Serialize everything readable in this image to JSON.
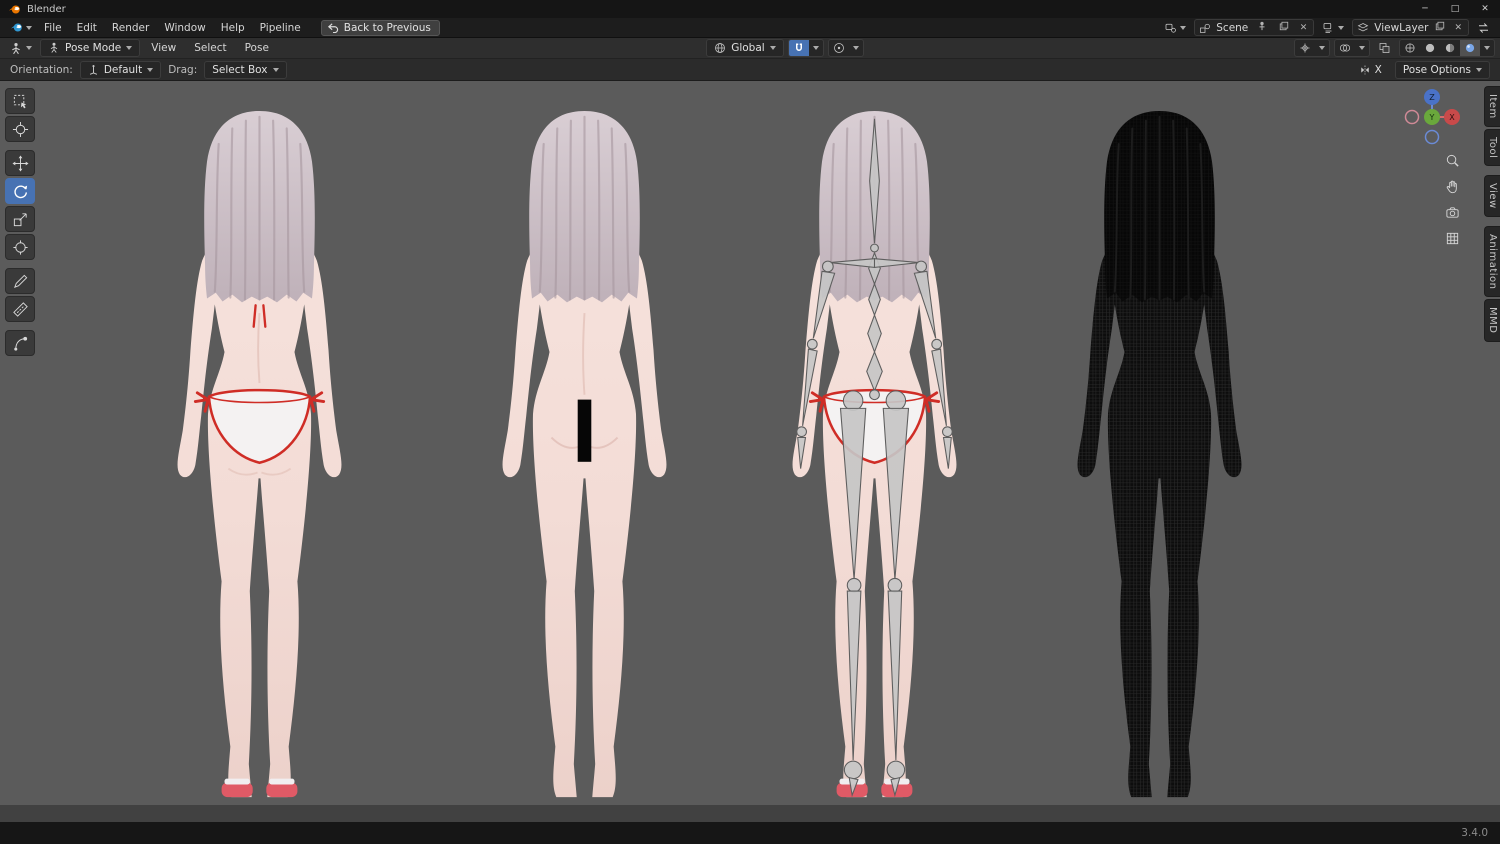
{
  "app": {
    "title": "Blender"
  },
  "icons": {
    "close": "✕",
    "minimize": "─",
    "maximize": "□"
  },
  "menubar": {
    "menus": [
      "File",
      "Edit",
      "Render",
      "Window",
      "Help",
      "Pipeline"
    ],
    "back_button": "Back to Previous",
    "scene": {
      "label": "Scene"
    },
    "viewlayer": {
      "label": "ViewLayer"
    }
  },
  "viewport_header": {
    "mode": "Pose Mode",
    "menus": [
      "View",
      "Select",
      "Pose"
    ],
    "orientation": "Global"
  },
  "tool_settings": {
    "orientation_label": "Orientation:",
    "orientation_value": "Default",
    "drag_label": "Drag:",
    "drag_value": "Select Box",
    "mirror_label": "X",
    "pose_options_label": "Pose Options"
  },
  "viewport": {
    "sidebar_tabs": [
      "Item",
      "Tool",
      "View",
      "Animation",
      "MMD"
    ],
    "gizmo_axes": {
      "z": "Z",
      "y": "Y",
      "x": "X"
    },
    "tools": [
      "select-box",
      "cursor",
      "move",
      "rotate",
      "scale",
      "transform",
      "annotate",
      "measure",
      "pose-breakdowner"
    ],
    "active_tool": "rotate",
    "models": [
      "bikini-textured",
      "nude-censored",
      "armature-overlay",
      "wireframe"
    ]
  },
  "statusbar": {
    "version": "3.4.0"
  },
  "colors": {
    "accent": "#4772b3",
    "viewport_bg": "#5b5b5b",
    "skin": "#f3dcd6",
    "hair": "#cfc2c8",
    "bikini_trim": "#cf2d26"
  }
}
